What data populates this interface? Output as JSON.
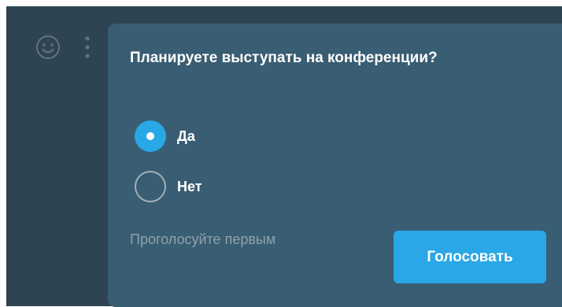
{
  "poll": {
    "question": "Планируете выступать на конференции?",
    "options": [
      {
        "label": "Да",
        "selected": true
      },
      {
        "label": "Нет",
        "selected": false
      }
    ],
    "hint": "Проголосуйте первым",
    "vote_label": "Голосовать"
  },
  "toolbar": {
    "icons": [
      "smiley-icon",
      "more-vertical-icon"
    ]
  },
  "colors": {
    "background": "#2e4452",
    "popup": "#395d72",
    "accent": "#2aa7e6",
    "hint_text": "#8ea2ad"
  }
}
